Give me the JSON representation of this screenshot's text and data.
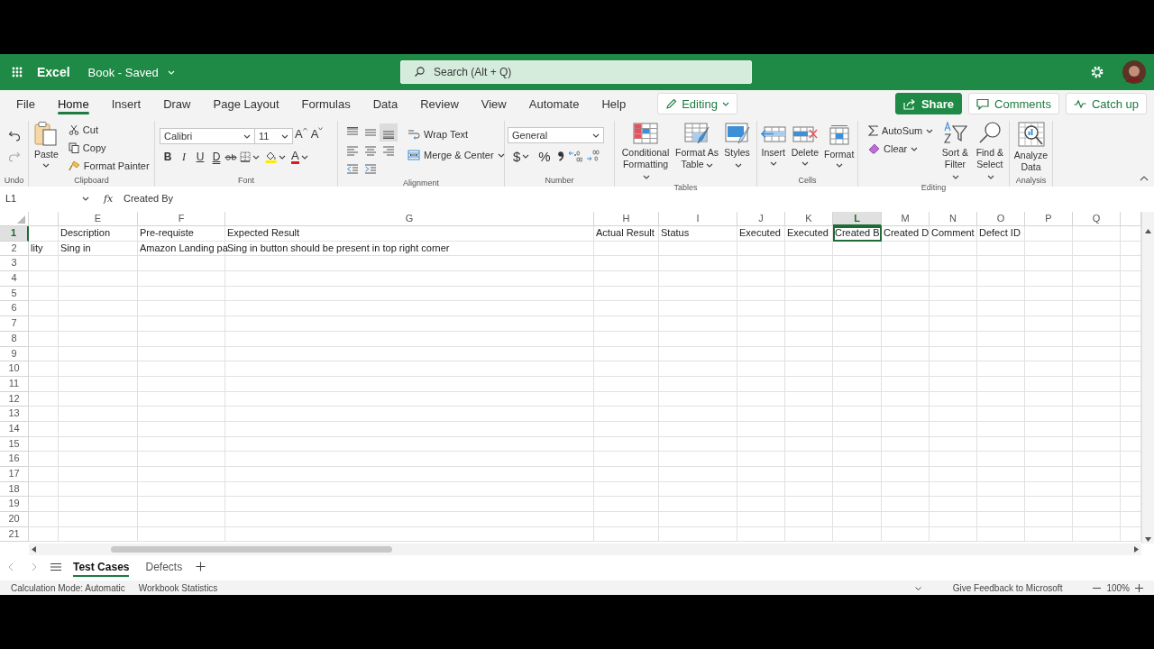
{
  "app": {
    "name": "Excel",
    "document": "Book - Saved"
  },
  "search": {
    "placeholder": "Search (Alt + Q)"
  },
  "menu_tabs": [
    {
      "label": "File",
      "selected": false
    },
    {
      "label": "Home",
      "selected": true
    },
    {
      "label": "Insert",
      "selected": false
    },
    {
      "label": "Draw",
      "selected": false
    },
    {
      "label": "Page Layout",
      "selected": false
    },
    {
      "label": "Formulas",
      "selected": false
    },
    {
      "label": "Data",
      "selected": false
    },
    {
      "label": "Review",
      "selected": false
    },
    {
      "label": "View",
      "selected": false
    },
    {
      "label": "Automate",
      "selected": false
    },
    {
      "label": "Help",
      "selected": false
    }
  ],
  "mode_button": {
    "label": "Editing"
  },
  "actions": [
    {
      "kind": "share",
      "label": "Share"
    },
    {
      "kind": "comments",
      "label": "Comments"
    },
    {
      "kind": "catch_up",
      "label": "Catch up"
    }
  ],
  "ribbon": [
    {
      "kind": "undo",
      "label": "Undo"
    },
    {
      "kind": "clipboard",
      "label": "Clipboard",
      "paste": "Paste",
      "items": [
        "Cut",
        "Copy",
        "Format Painter"
      ]
    },
    {
      "kind": "font",
      "label": "Font",
      "font": "Calibri",
      "size": "11",
      "size_buttons": [
        "A",
        "A"
      ],
      "styles": [
        "B",
        "I",
        "U",
        "D"
      ],
      "font_color": "A"
    },
    {
      "kind": "alignment",
      "label": "Alignment",
      "vertical_align": [
        {
          "selected": false
        },
        {
          "selected": false
        },
        {
          "selected": true
        }
      ],
      "wrap": "Wrap Text",
      "merge": "Merge & Center"
    },
    {
      "kind": "number",
      "label": "Number",
      "format": "General",
      "symbols": [
        "$",
        "%"
      ]
    },
    {
      "kind": "tables",
      "label": "Tables",
      "items": [
        "Conditional Formatting",
        "Format As Table",
        "Styles"
      ]
    },
    {
      "kind": "cells",
      "label": "Cells",
      "items": [
        "Insert",
        "Delete",
        "Format"
      ]
    },
    {
      "kind": "editing",
      "label": "Editing",
      "autosum": "AutoSum",
      "clear": "Clear",
      "items": [
        "Sort & Filter",
        "Find & Select"
      ]
    },
    {
      "kind": "analysis",
      "label": "Analysis",
      "items": [
        "Analyze Data"
      ]
    }
  ],
  "formula_bar": {
    "name_box": "L1",
    "function_label": "fx",
    "value": "Created By"
  },
  "sheet": {
    "columns": [
      {
        "selected": false
      },
      {
        "label": "E",
        "selected": false
      },
      {
        "label": "F",
        "selected": false
      },
      {
        "label": "G",
        "selected": false
      },
      {
        "label": "H",
        "selected": false
      },
      {
        "label": "I",
        "selected": false
      },
      {
        "label": "J",
        "selected": false
      },
      {
        "label": "K",
        "selected": false
      },
      {
        "label": "L",
        "selected": true
      },
      {
        "label": "M",
        "selected": false
      },
      {
        "label": "N",
        "selected": false
      },
      {
        "label": "O",
        "selected": false
      },
      {
        "label": "P",
        "selected": false
      },
      {
        "label": "Q",
        "selected": false
      }
    ],
    "rows": [
      {
        "label": "1",
        "selected": true,
        "cells": [
          null,
          "Description",
          "Pre-requiste",
          "Expected Result",
          "Actual Result",
          "Status",
          "Executed",
          "Executed",
          "Created B",
          "Created D",
          "Comment",
          "Defect ID"
        ]
      },
      {
        "label": "2",
        "selected": false,
        "cells": [
          "lity",
          "Sing in",
          "Amazon Landing pa",
          "Sing in button should be present in top right corner"
        ]
      },
      {
        "label": "3",
        "selected": false
      },
      {
        "label": "4",
        "selected": false
      },
      {
        "label": "5",
        "selected": false
      },
      {
        "label": "6",
        "selected": false
      },
      {
        "label": "7",
        "selected": false
      },
      {
        "label": "8",
        "selected": false
      },
      {
        "label": "9",
        "selected": false
      },
      {
        "label": "10",
        "selected": false
      },
      {
        "label": "11",
        "selected": false
      },
      {
        "label": "12",
        "selected": false
      },
      {
        "label": "13",
        "selected": false
      },
      {
        "label": "14",
        "selected": false
      },
      {
        "label": "15",
        "selected": false
      },
      {
        "label": "16",
        "selected": false
      },
      {
        "label": "17",
        "selected": false
      },
      {
        "label": "18",
        "selected": false
      },
      {
        "label": "19",
        "selected": false
      },
      {
        "label": "20",
        "selected": false
      },
      {
        "label": "21",
        "selected": false
      }
    ]
  },
  "sheet_tabs": [
    {
      "label": "Test Cases",
      "selected": true
    },
    {
      "label": "Defects",
      "selected": false
    }
  ],
  "status_bar": {
    "items": [
      "Calculation Mode: Automatic",
      "Workbook Statistics"
    ],
    "feedback": "Give Feedback to Microsoft",
    "zoom": "100%"
  }
}
